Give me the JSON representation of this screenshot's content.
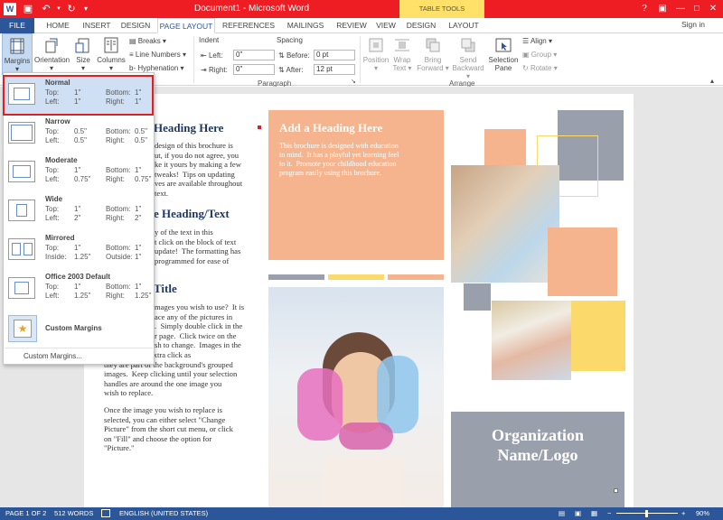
{
  "window": {
    "title": "Document1 - Microsoft Word",
    "contextual_tab_group": "TABLE TOOLS"
  },
  "tabs": [
    "FILE",
    "HOME",
    "INSERT",
    "DESIGN",
    "PAGE LAYOUT",
    "REFERENCES",
    "MAILINGS",
    "REVIEW",
    "VIEW",
    "DESIGN",
    "LAYOUT"
  ],
  "signin": "Sign in",
  "ribbon": {
    "margins": "Margins",
    "orientation": "Orientation",
    "size": "Size",
    "columns": "Columns",
    "breaks": "Breaks",
    "line_numbers": "Line Numbers",
    "hyphenation": "Hyphenation",
    "indent_title": "Indent",
    "indent_left_label": "Left:",
    "indent_left_value": "0\"",
    "indent_right_label": "Right:",
    "indent_right_value": "0\"",
    "spacing_title": "Spacing",
    "spacing_before_label": "Before:",
    "spacing_before_value": "0 pt",
    "spacing_after_label": "After:",
    "spacing_after_value": "12 pt",
    "paragraph_group": "Paragraph",
    "position": "Position",
    "wrap_text_1": "Wrap",
    "wrap_text_2": "Text",
    "bring_forward_1": "Bring",
    "bring_forward_2": "Forward",
    "send_backward_1": "Send",
    "send_backward_2": "Backward",
    "selection_pane_1": "Selection",
    "selection_pane_2": "Pane",
    "align": "Align",
    "group": "Group",
    "rotate": "Rotate",
    "arrange_group": "Arrange"
  },
  "margins_menu": {
    "options": [
      {
        "name": "Normal",
        "k1": "Top:",
        "v1": "1\"",
        "k2": "Bottom:",
        "v2": "1\"",
        "k3": "Left:",
        "v3": "1\"",
        "k4": "Right:",
        "v4": "1\""
      },
      {
        "name": "Narrow",
        "k1": "Top:",
        "v1": "0.5\"",
        "k2": "Bottom:",
        "v2": "0.5\"",
        "k3": "Left:",
        "v3": "0.5\"",
        "k4": "Right:",
        "v4": "0.5\""
      },
      {
        "name": "Moderate",
        "k1": "Top:",
        "v1": "1\"",
        "k2": "Bottom:",
        "v2": "1\"",
        "k3": "Left:",
        "v3": "0.75\"",
        "k4": "Right:",
        "v4": "0.75\""
      },
      {
        "name": "Wide",
        "k1": "Top:",
        "v1": "1\"",
        "k2": "Bottom:",
        "v2": "1\"",
        "k3": "Left:",
        "v3": "2\"",
        "k4": "Right:",
        "v4": "2\""
      },
      {
        "name": "Mirrored",
        "k1": "Top:",
        "v1": "1\"",
        "k2": "Bottom:",
        "v2": "1\"",
        "k3": "Inside:",
        "v3": "1.25\"",
        "k4": "Outside:",
        "v4": "1\""
      },
      {
        "name": "Office 2003 Default",
        "k1": "Top:",
        "v1": "1\"",
        "k2": "Bottom:",
        "v2": "1\"",
        "k3": "Left:",
        "v3": "1.25\"",
        "k4": "Right:",
        "v4": "1.25\""
      }
    ],
    "custom_margins": "Custom Margins",
    "custom_margins_link": "Custom Margins..."
  },
  "document": {
    "col1_heading1": "Heading Here",
    "col1_text1": "design of this brochure is\nut, if you do not agree, you\nke it yours by making a few\ntweaks!  Tips on updating\nves are available throughout\ntext.",
    "col1_heading2": "e Heading/Text",
    "col1_text2": "y of the text in this\nt click on the block of text\nupdate!  The formatting has\nprogrammed for ease of",
    "col1_heading3": "Title",
    "col1_text3a": "mages you wish to use?  It is\nace any of the pictures in\n.  Simply double click in the\nr page.  Click twice on the\nsh to change.  Images in the",
    "col1_text3b": "might need an extra click as\nthey are part of the background's grouped\nimages.  Keep clicking until your selection\nhandles are around the one image you\nwish to replace.",
    "col1_text4": "Once the image you wish to replace is\nselected, you can either select \"Change\nPicture\" from the short cut menu, or click\non \"Fill\" and choose the option for\n\"Picture.\"",
    "col2_heading": "Add a Heading Here",
    "col2_text": "This brochure is designed with education\nin mind.  It has a playful yet learning feel\nto it.  Promote your childhood education\nprogram easily using this brochure.",
    "org_line1": "Organization",
    "org_line2": "Name/Logo"
  },
  "status": {
    "page": "PAGE 1 OF 2",
    "words": "512 WORDS",
    "language": "ENGLISH (UNITED STATES)",
    "zoom": "90%"
  }
}
